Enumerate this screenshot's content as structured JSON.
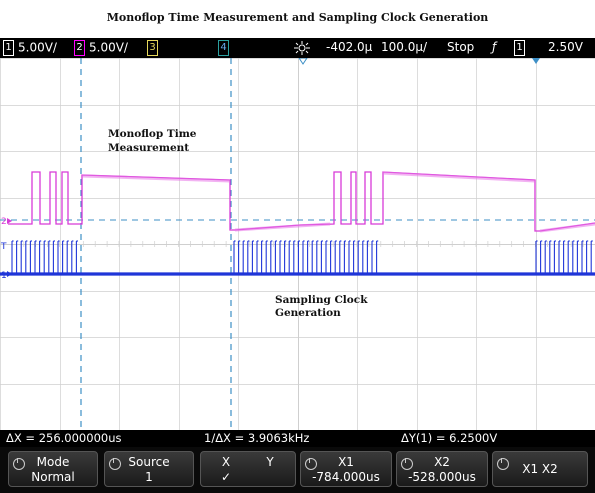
{
  "title": "Monoflop Time Measurement and Sampling Clock Generation",
  "status": {
    "ch1_num": "1",
    "ch1_scale": "5.00V/",
    "ch2_num": "2",
    "ch2_scale": "5.00V/",
    "ch3_num": "3",
    "ch4_num": "4",
    "trigger_pos": "-402.0µ",
    "timebase": "100.0µ/",
    "run_state": "Stop",
    "trigger_slope": "ƒ",
    "trigger_ch": "1",
    "trigger_level": "2.50V"
  },
  "annotations": {
    "monoflop_line1": "Monoflop Time",
    "monoflop_line2": "Measurement",
    "clock_line1": "Sampling Clock",
    "clock_line2": "Generation"
  },
  "markers": {
    "ch2_marker": "2",
    "trig_marker": "T",
    "ch1_marker": "1"
  },
  "readout": {
    "delta_x": "ΔX = 256.000000us",
    "inv_delta_x": "1/ΔX = 3.9063kHz",
    "delta_y": "ΔY(1) = 6.2500V"
  },
  "softkeys": {
    "mode_label": "Mode",
    "mode_value": "Normal",
    "source_label": "Source",
    "source_value": "1",
    "x_label": "X",
    "y_label": "Y",
    "xy_check": "✓",
    "x1_label": "X1",
    "x1_value": "-784.000us",
    "x2_label": "X2",
    "x2_value": "-528.000us",
    "x1x2_label": "X1 X2"
  },
  "colors": {
    "ch1_trace": "#1f35d8",
    "ch2_trace": "#d83ad8",
    "cursor": "#3d8fc6",
    "grid": "#cfcfcf"
  }
}
